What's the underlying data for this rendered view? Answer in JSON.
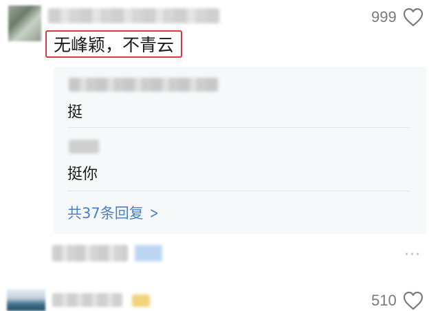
{
  "comments": [
    {
      "text": "无峰颖，不青云",
      "likes": "999",
      "replies": [
        {
          "text": "挺"
        },
        {
          "text": "挺你"
        }
      ],
      "more_replies_label": "共37条回复",
      "more_replies_icon": "chevron-right-icon",
      "more_icon": "more-dots-icon"
    },
    {
      "likes": "510"
    }
  ],
  "colors": {
    "highlight_border": "#d63a3a",
    "link": "#4a7fc7",
    "panel_bg": "#f7f8fa",
    "like_count": "#7a7a7a"
  },
  "icons": {
    "like": "heart-outline-icon",
    "more": "ellipsis-icon"
  }
}
